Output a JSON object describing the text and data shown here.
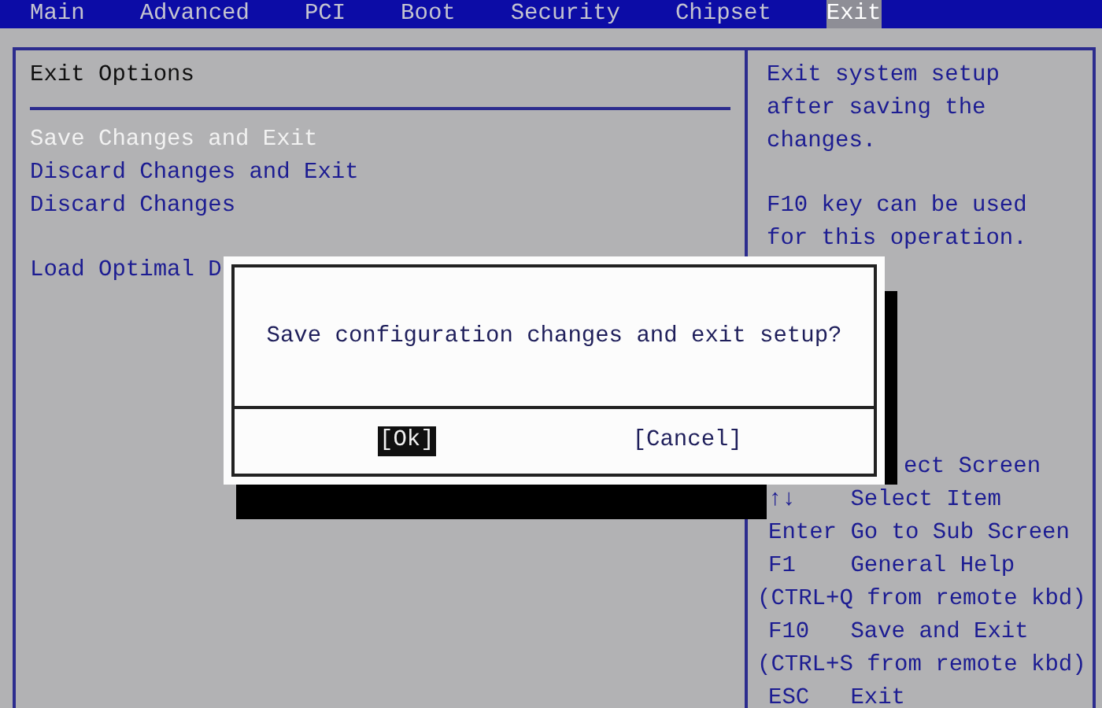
{
  "menu": [
    {
      "label": "Main",
      "selected": false
    },
    {
      "label": "Advanced",
      "selected": false
    },
    {
      "label": "PCI",
      "selected": false
    },
    {
      "label": "Boot",
      "selected": false
    },
    {
      "label": "Security",
      "selected": false
    },
    {
      "label": "Chipset",
      "selected": false
    },
    {
      "label": "Exit",
      "selected": true
    }
  ],
  "options": {
    "title": "Exit Options",
    "groups": [
      [
        {
          "label": "Save Changes and Exit",
          "selected": true
        },
        {
          "label": "Discard Changes and Exit",
          "selected": false
        },
        {
          "label": "Discard Changes",
          "selected": false
        }
      ],
      [
        {
          "label": "Load Optimal D",
          "selected": false
        }
      ]
    ]
  },
  "help": {
    "paragraphs": [
      "Exit system setup after saving the changes.",
      "F10 key can be used for this operation."
    ],
    "keys": [
      {
        "kind": "cut",
        "description": "ect Screen"
      },
      {
        "kind": "key",
        "key": "↑↓",
        "description": "Select Item"
      },
      {
        "kind": "key",
        "key": "Enter",
        "description": "Go to Sub Screen"
      },
      {
        "kind": "key",
        "key": "F1",
        "description": "General Help"
      },
      {
        "kind": "note",
        "description": "(CTRL+Q from remote kbd)"
      },
      {
        "kind": "key",
        "key": "F10",
        "description": "Save and Exit"
      },
      {
        "kind": "note",
        "description": "(CTRL+S from remote kbd)"
      },
      {
        "kind": "key",
        "key": "ESC",
        "description": "Exit"
      }
    ]
  },
  "dialog": {
    "message": "Save configuration changes and exit setup?",
    "buttons": [
      {
        "label": "[Ok]",
        "selected": true
      },
      {
        "label": "[Cancel]",
        "selected": false
      }
    ]
  }
}
